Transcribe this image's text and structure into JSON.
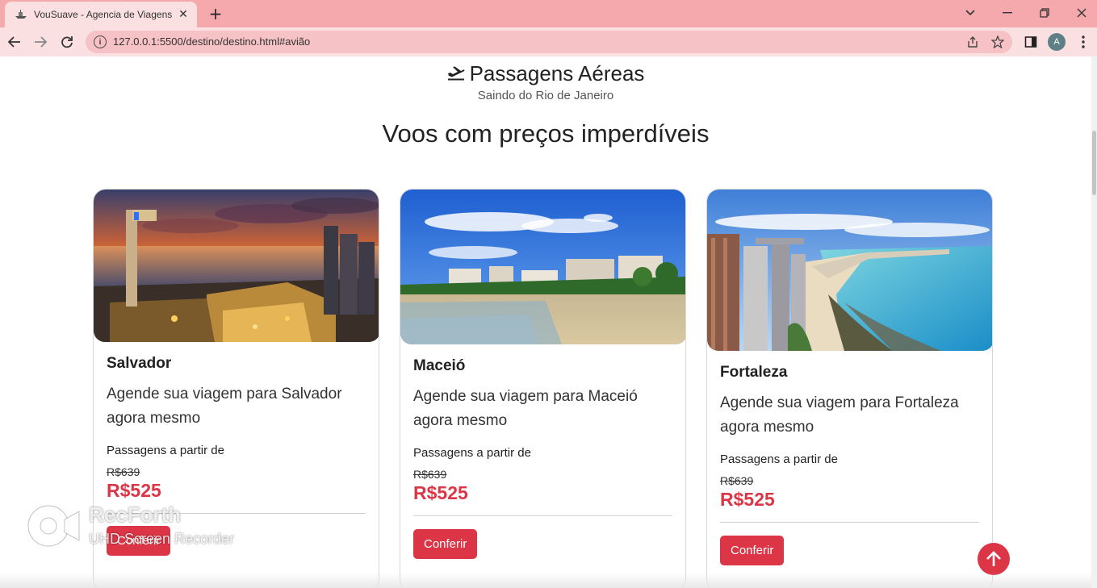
{
  "browser": {
    "tab_title": "VouSuave - Agencia de Viagens",
    "url": "127.0.0.1:5500/destino/destino.html#avião",
    "profile_initial": "A"
  },
  "header": {
    "title": "Passagens Aéreas",
    "subtitle": "Saindo do Rio de Janeiro",
    "section_title": "Voos com preços imperdíveis"
  },
  "cards": [
    {
      "city": "Salvador",
      "text": "Agende sua viagem para Salvador agora mesmo",
      "from_label": "Passagens a partir de",
      "old_price": "R$639",
      "price": "R$525",
      "button": "Conferir"
    },
    {
      "city": "Maceió",
      "text": "Agende sua viagem para Maceió agora mesmo",
      "from_label": "Passagens a partir de",
      "old_price": "R$639",
      "price": "R$525",
      "button": "Conferir"
    },
    {
      "city": "Fortaleza",
      "text": "Agende sua viagem para Fortaleza agora mesmo",
      "from_label": "Passagens a partir de",
      "old_price": "R$639",
      "price": "R$525",
      "button": "Conferir"
    }
  ],
  "watermark": {
    "name": "RecForth",
    "sub": "UHD Screen Recorder"
  },
  "colors": {
    "tabbar": "#f5a9ad",
    "toolbar": "#fbe0e2",
    "accent": "#dc3545"
  }
}
